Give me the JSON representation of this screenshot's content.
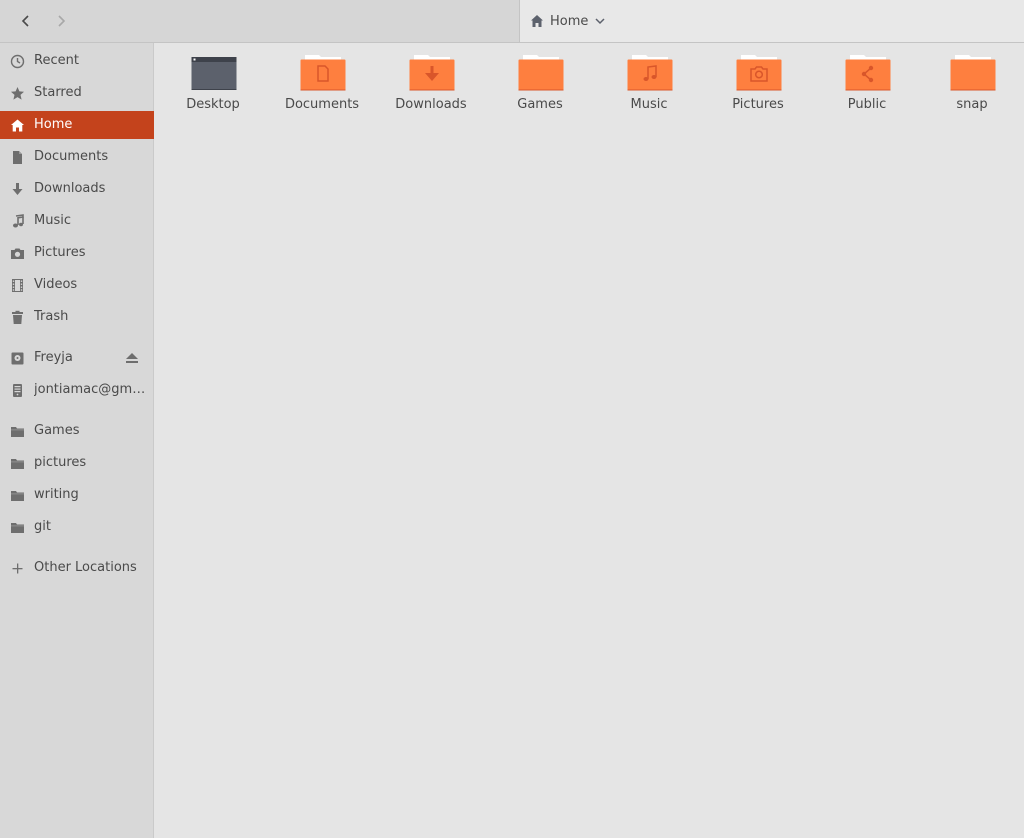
{
  "header": {
    "back_icon": "chevron-left-icon",
    "forward_icon": "chevron-right-icon",
    "location": {
      "icon": "home-icon",
      "label": "Home",
      "dropdown_icon": "chevron-down-icon"
    }
  },
  "sidebar": {
    "accent_color": "#c4431c",
    "places": [
      {
        "label": "Recent",
        "icon": "clock-icon"
      },
      {
        "label": "Starred",
        "icon": "star-icon"
      },
      {
        "label": "Home",
        "icon": "home-icon",
        "active": true
      },
      {
        "label": "Documents",
        "icon": "document-icon"
      },
      {
        "label": "Downloads",
        "icon": "download-icon"
      },
      {
        "label": "Music",
        "icon": "music-icon"
      },
      {
        "label": "Pictures",
        "icon": "camera-icon"
      },
      {
        "label": "Videos",
        "icon": "film-icon"
      },
      {
        "label": "Trash",
        "icon": "trash-icon"
      }
    ],
    "devices": [
      {
        "label": "Freyja",
        "icon": "drive-icon",
        "eject_icon": "eject-icon"
      },
      {
        "label": "jontiamac@gma…",
        "icon": "network-server-icon"
      }
    ],
    "bookmarks": [
      {
        "label": "Games",
        "icon": "folder-icon"
      },
      {
        "label": "pictures",
        "icon": "folder-icon"
      },
      {
        "label": "writing",
        "icon": "folder-icon"
      },
      {
        "label": "git",
        "icon": "folder-icon"
      }
    ],
    "other": {
      "label": "Other Locations",
      "icon": "plus-icon"
    }
  },
  "files": [
    {
      "name": "Desktop",
      "icon": "desktop-folder-icon"
    },
    {
      "name": "Documents",
      "icon": "documents-folder-icon"
    },
    {
      "name": "Downloads",
      "icon": "downloads-folder-icon"
    },
    {
      "name": "Games",
      "icon": "folder-icon"
    },
    {
      "name": "Music",
      "icon": "music-folder-icon"
    },
    {
      "name": "Pictures",
      "icon": "pictures-folder-icon"
    },
    {
      "name": "Public",
      "icon": "public-folder-icon"
    },
    {
      "name": "snap",
      "icon": "folder-icon"
    }
  ],
  "colors": {
    "folder": "#fe7f3f",
    "folder_dark": "#d9562a",
    "desktop_folder": "#5c616c"
  }
}
